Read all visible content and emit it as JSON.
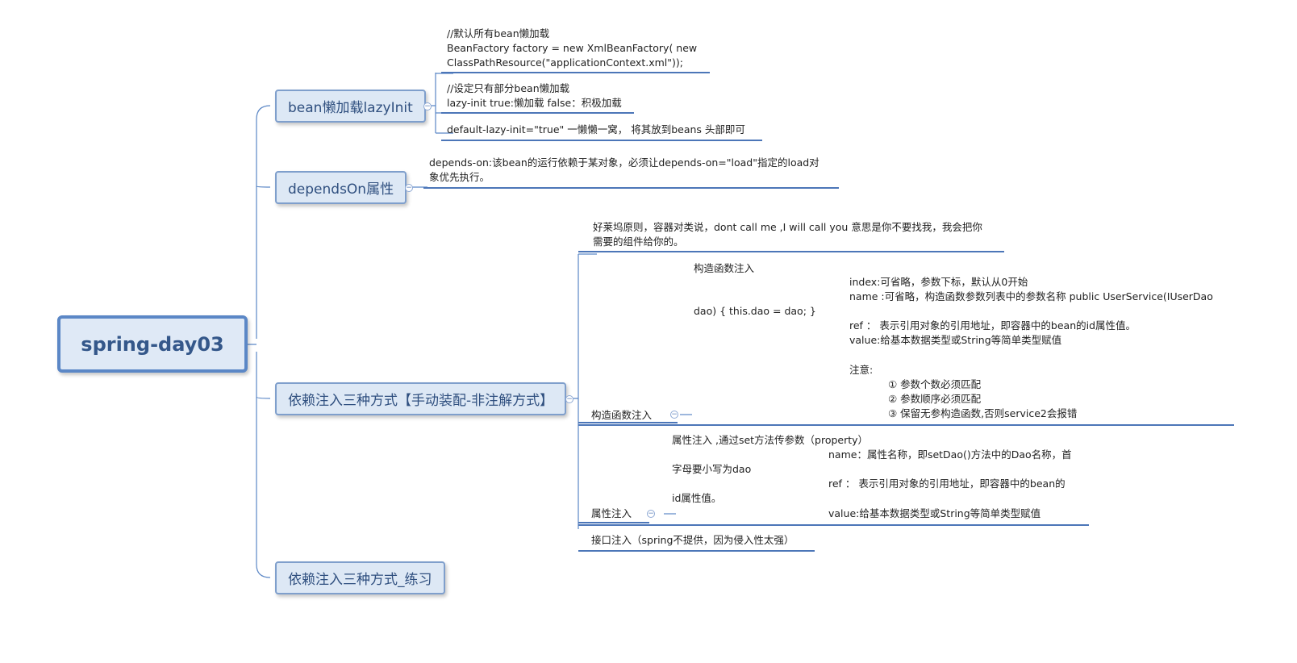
{
  "root": {
    "label": "spring-day03"
  },
  "colors": {
    "line": "#5b87c6",
    "node_fill": "#dde8f5",
    "node_border": "#7f9fcc",
    "node_text": "#2f4f7f"
  },
  "icons": {
    "collapse": "collapse-minus-icon",
    "collapse_glyph": "−"
  },
  "branches": {
    "lazy": {
      "label": "bean懒加载lazyInit",
      "notes": [
        [
          "//默认所有bean懒加载",
          "BeanFactory factory = new  XmlBeanFactory( new",
          "ClassPathResource(\"applicationContext.xml\"));"
        ],
        [
          "//设定只有部分bean懒加载",
          "lazy-init true:懒加载 false：积极加载"
        ],
        [
          "default-lazy-init=\"true\" 一懒懒一窝， 将其放到beans 头部即可"
        ]
      ]
    },
    "depends": {
      "label": "dependsOn属性",
      "note": [
        "depends-on:该bean的运行依赖于某对象，必须让depends-on=\"load\"指定的load对",
        "象优先执行。"
      ]
    },
    "di": {
      "label": "依赖注入三种方式【手动装配-非注解方式】",
      "intro": [
        "好莱坞原则，容器对类说，dont call me ,I will call you 意思是你不要找我，我会把你",
        "需要的组件给你的。"
      ],
      "ctor": {
        "label": "构造函数注入",
        "title": "构造函数注入",
        "index": "index:可省略，参数下标，默认从0开始",
        "name": "name :可省略，构造函数参数列表中的参数名称 public UserService(IUserDao",
        "cont": "dao) { this.dao = dao; }",
        "ref": "ref ： 表示引用对象的引用地址，即容器中的bean的id属性值。",
        "value": "value:给基本数据类型或String等简单类型赋值",
        "note_title": "注意:",
        "notes": [
          "① 参数个数必须匹配",
          "② 参数顺序必须匹配",
          "③ 保留无参构造函数,否则service2会报错"
        ]
      },
      "prop": {
        "label": "属性注入",
        "title": "属性注入 ,通过set方法传参数（property）",
        "name": "name：属性名称，即setDao()方法中的Dao名称，首",
        "name_cont": "字母要小写为dao",
        "ref": "ref ： 表示引用对象的引用地址，即容器中的bean的",
        "ref_cont": "id属性值。",
        "value": "value:给基本数据类型或String等简单类型赋值"
      },
      "iface": {
        "label": "接口注入（spring不提供，因为侵入性太强）"
      }
    },
    "practice": {
      "label": "依赖注入三种方式_练习"
    }
  }
}
